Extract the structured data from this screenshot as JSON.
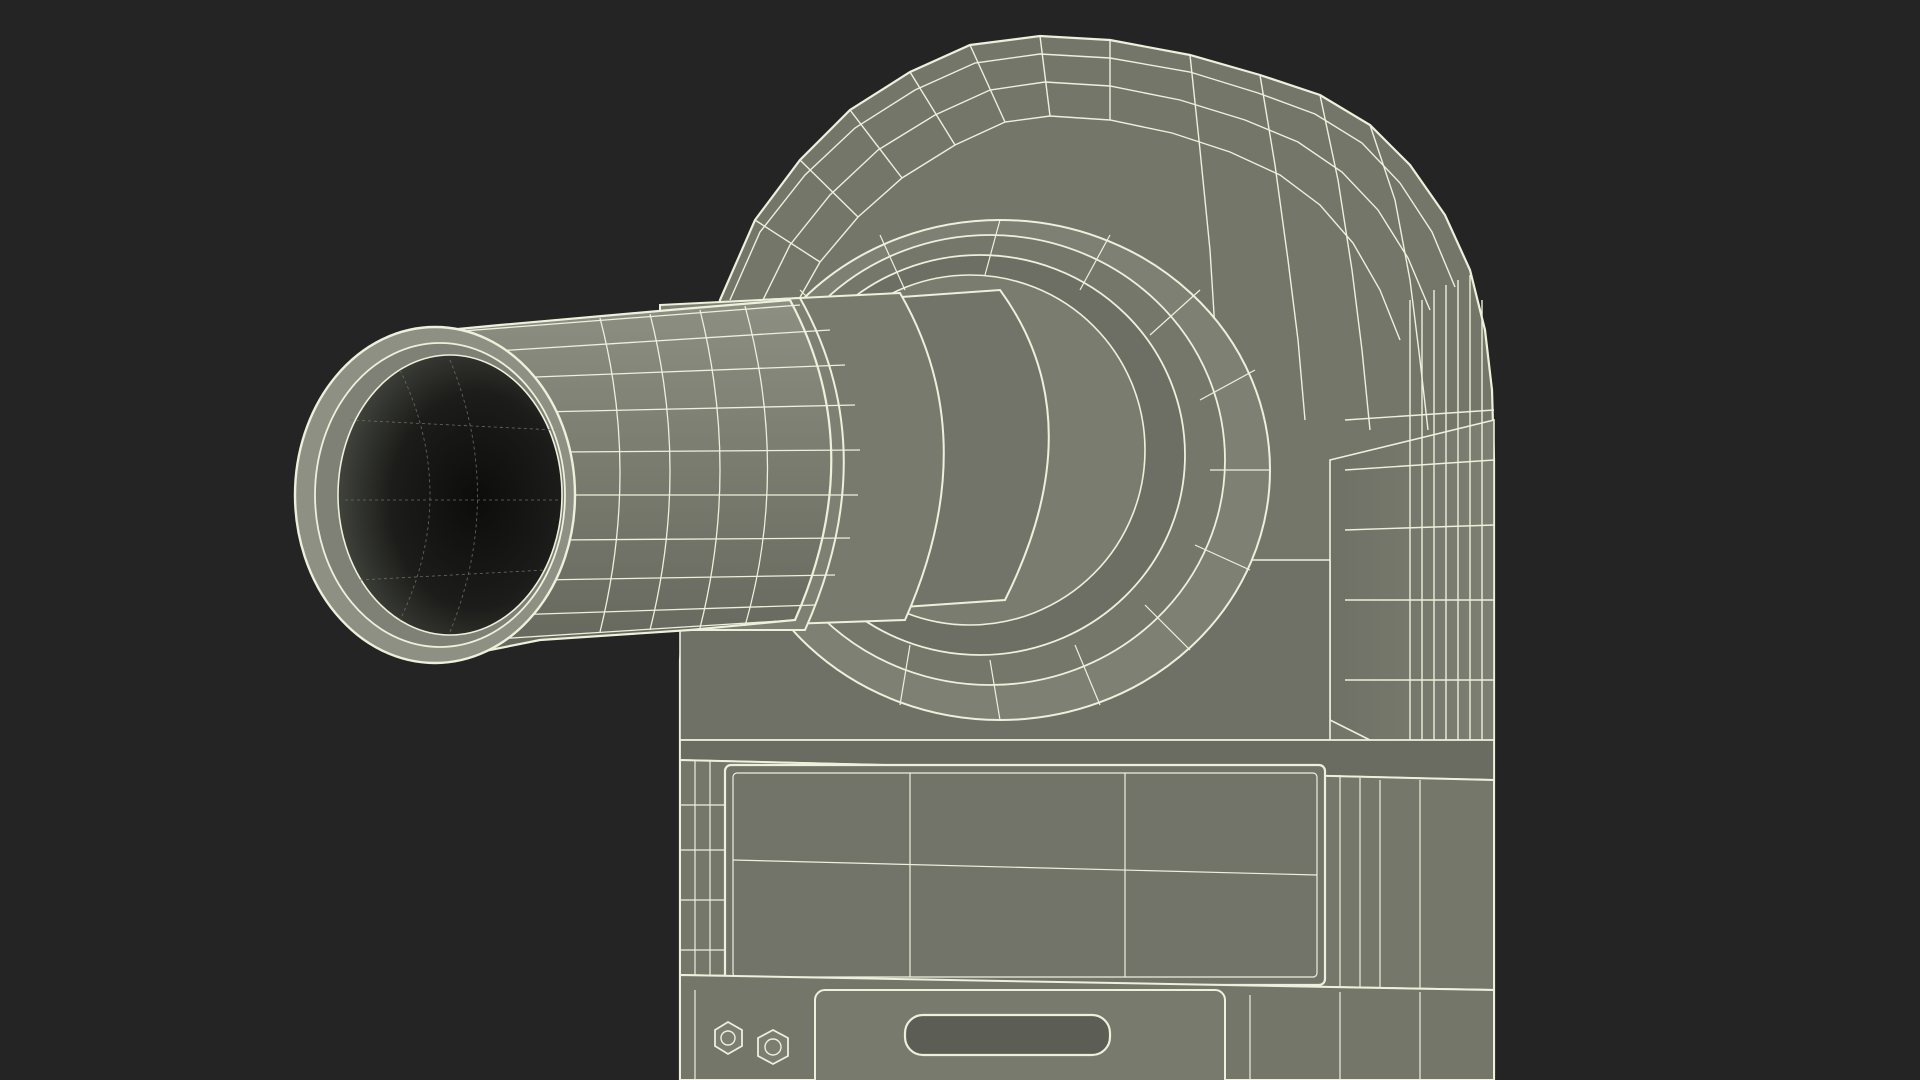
{
  "scene": {
    "background_color": "#242424",
    "surface_color": "#74766a",
    "surface_light_color": "#8a8c80",
    "surface_dark_color": "#5f6157",
    "wire_color": "#eef0dc",
    "cavity_color": "#101010",
    "subject": "wireframe-3d-model-device-with-tube"
  }
}
